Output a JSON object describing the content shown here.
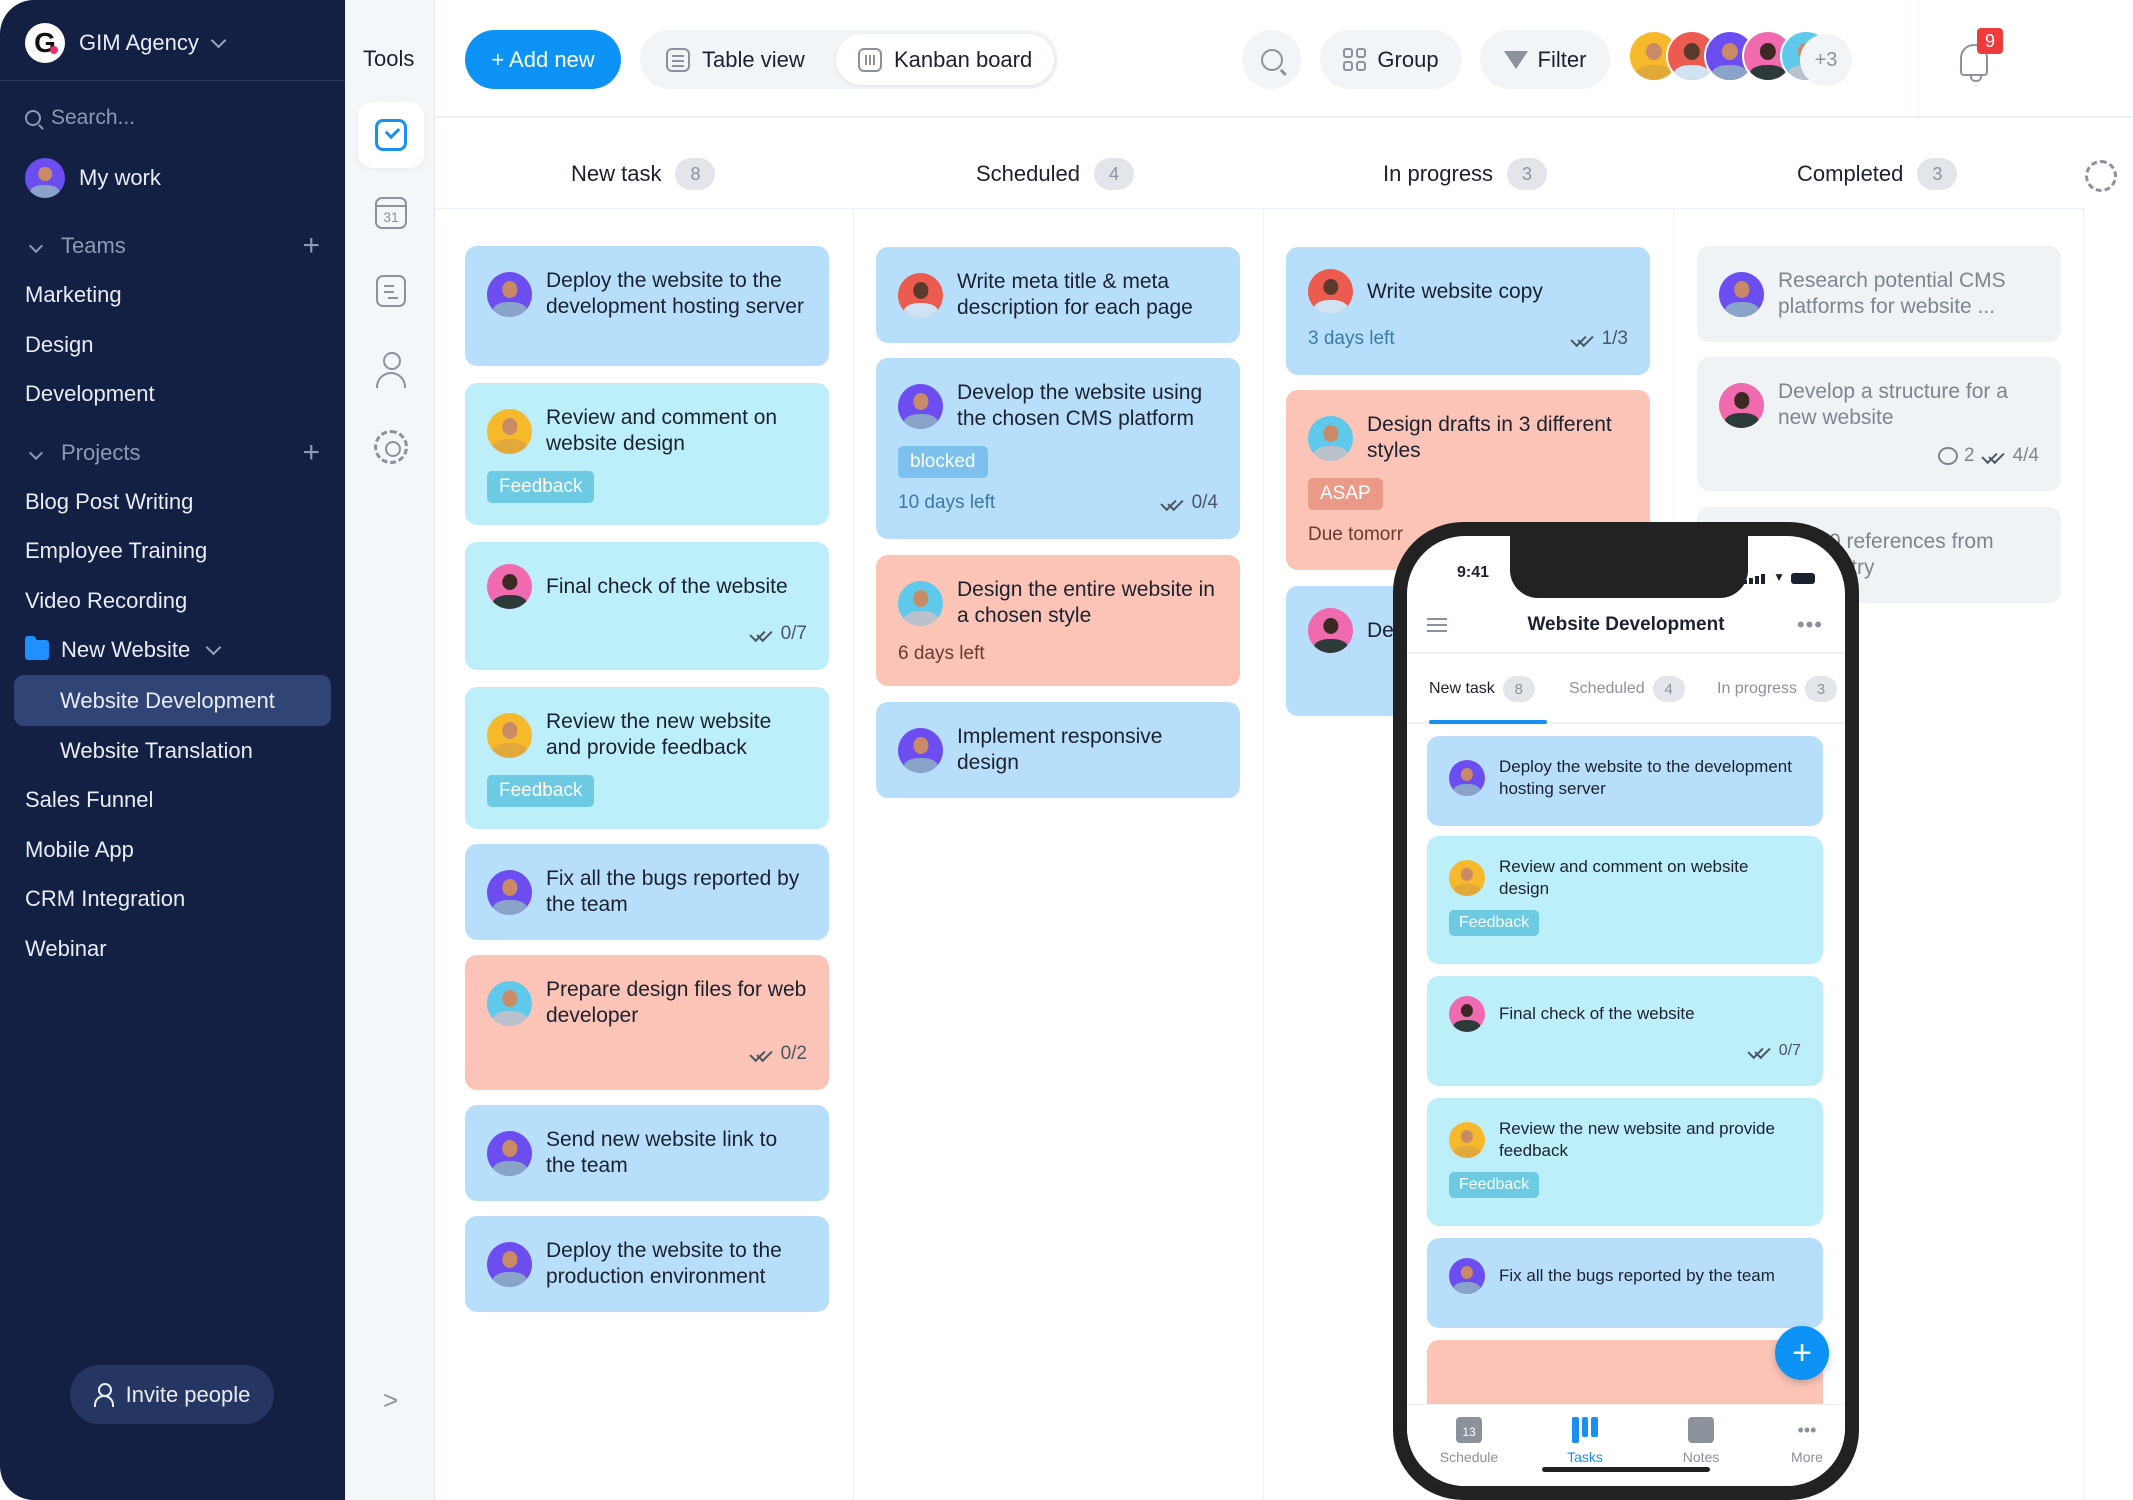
{
  "sidebar": {
    "workspace": "GIM Agency",
    "search_placeholder": "Search...",
    "my_work": "My work",
    "teams_label": "Teams",
    "teams": [
      "Marketing",
      "Design",
      "Development"
    ],
    "projects_label": "Projects",
    "projects": [
      "Blog Post Writing",
      "Employee Training",
      "Video Recording"
    ],
    "folder": "New Website",
    "folder_items": [
      "Website Development",
      "Website Translation"
    ],
    "more_projects": [
      "Sales Funnel",
      "Mobile App",
      "CRM Integration",
      "Webinar"
    ],
    "invite": "Invite people"
  },
  "tools": {
    "title": "Tools",
    "items": [
      "tasks-icon",
      "calendar-icon",
      "notes-icon",
      "user-icon",
      "settings-icon"
    ],
    "calendar_day": "31"
  },
  "toolbar": {
    "add_new": "+ Add new",
    "table_view": "Table view",
    "kanban_board": "Kanban board",
    "group": "Group",
    "filter": "Filter",
    "more_members": "+3",
    "notifications": "9"
  },
  "colors": {
    "accent": "#0c93f5",
    "sidebar_bg": "#131f43",
    "card_blue": "#b7dffb",
    "card_cyan": "#bdeffa",
    "card_salmon": "#fbc4b7",
    "card_gray": "#f0f3f5",
    "badge_red": "#ef3b3b"
  },
  "columns": [
    {
      "name": "New task",
      "count": "8"
    },
    {
      "name": "Scheduled",
      "count": "4"
    },
    {
      "name": "In progress",
      "count": "3"
    },
    {
      "name": "Completed",
      "count": "3"
    }
  ],
  "cards": {
    "new_task": [
      {
        "title": "Deploy the website to the development hosting server"
      },
      {
        "title": "Review and comment on website design",
        "tag": "Feedback"
      },
      {
        "title": "Final check of the website",
        "checklist": "0/7"
      },
      {
        "title": "Review the new website and provide feedback",
        "tag": "Feedback"
      },
      {
        "title": "Fix all the bugs reported by the team"
      },
      {
        "title": "Prepare design files for web developer",
        "checklist": "0/2"
      },
      {
        "title": "Send new website link to the team"
      },
      {
        "title": "Deploy the website to the production environment"
      }
    ],
    "scheduled": [
      {
        "title": "Write meta title & meta description for each page"
      },
      {
        "title": "Develop the website using the chosen CMS platform",
        "tag": "blocked",
        "due": "10 days left",
        "checklist": "0/4"
      },
      {
        "title": "Design the entire website in a chosen style",
        "due": "6 days left"
      },
      {
        "title": "Implement responsive design"
      }
    ],
    "in_progress": [
      {
        "title": "Write website copy",
        "due": "3 days left",
        "checklist": "1/3"
      },
      {
        "title": "Design drafts in 3 different styles",
        "tag": "ASAP",
        "due": "Due tomorr"
      },
      {
        "title": "De"
      }
    ],
    "completed": [
      {
        "title": "Research potential CMS platforms for website ..."
      },
      {
        "title": "Develop a structure for a new website",
        "comments": "2",
        "checklist": "4/4"
      },
      {
        "title": "0 references from",
        "title2": "ustry"
      }
    ]
  },
  "phone": {
    "time": "9:41",
    "title": "Website Development",
    "tabs": [
      {
        "name": "New task",
        "count": "8"
      },
      {
        "name": "Scheduled",
        "count": "4"
      },
      {
        "name": "In progress",
        "count": "3"
      }
    ],
    "cards": [
      {
        "title": "Deploy the website to the development hosting server"
      },
      {
        "title": "Review and comment on website design",
        "tag": "Feedback"
      },
      {
        "title": "Final check of the website",
        "checklist": "0/7"
      },
      {
        "title": "Review the new website and provide feedback",
        "tag": "Feedback"
      },
      {
        "title": "Fix all the bugs reported by the team"
      }
    ],
    "fab": "+",
    "nav": [
      {
        "label": "Schedule",
        "day": "13"
      },
      {
        "label": "Tasks"
      },
      {
        "label": "Notes"
      },
      {
        "label": "More"
      }
    ]
  }
}
